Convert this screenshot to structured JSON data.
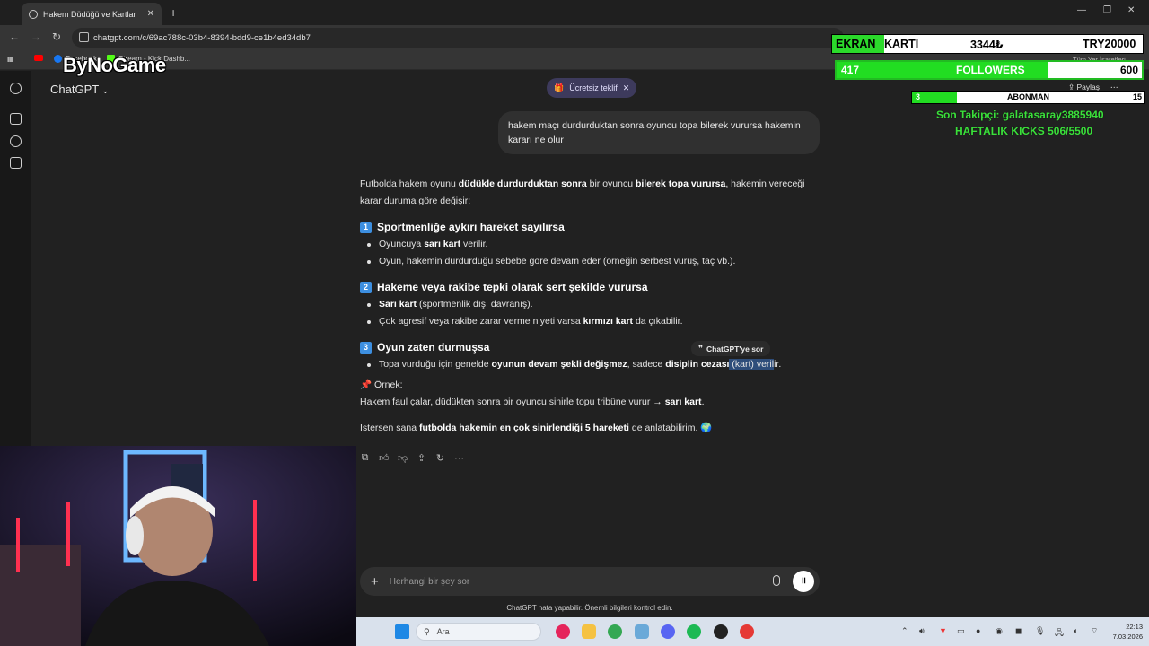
{
  "browser": {
    "tab_title": "Hakem Düdüğü ve Kartlar",
    "url": "chatgpt.com/c/69ac788c-03b4-8394-bdd9-ce1b4ed34db7",
    "bookmarks": [
      "Facebook",
      "Stream - Kick Dashb..."
    ],
    "all_bookmarks": "Tüm Yer İşaretleri"
  },
  "stream_logo": "ByNoGame",
  "app": {
    "model_label": "ChatGPT",
    "offer_label": "Ücretsiz teklif",
    "share_label": "Paylaş"
  },
  "chat": {
    "user_message": "hakem maçı durdurduktan sonra oyuncu topa bilerek vurursa hakemin kararı ne olur",
    "intro": {
      "p1": "Futbolda hakem oyunu ",
      "b1": "düdükle durdurduktan sonra",
      "p2": " bir oyuncu ",
      "b2": "bilerek topa vurursa",
      "p3": ", hakemin vereceği karar duruma göre değişir:"
    },
    "sections": [
      {
        "num": "1",
        "title": "Sportmenliğe aykırı hareket sayılırsa",
        "b1_pre": "Oyuncuya ",
        "b1_bold": "sarı kart",
        "b1_post": " verilir.",
        "b2": "Oyun, hakemin durdurduğu sebebe göre devam eder (örneğin serbest vuruş, taç vb.)."
      },
      {
        "num": "2",
        "title": "Hakeme veya rakibe tepki olarak sert şekilde vurursa",
        "b1_bold": "Sarı kart",
        "b1_post": " (sportmenlik dışı davranış).",
        "b2_pre": "Çok agresif veya rakibe zarar verme niyeti varsa ",
        "b2_bold": "kırmızı kart",
        "b2_post": " da çıkabilir."
      },
      {
        "num": "3",
        "title": "Oyun zaten durmuşsa",
        "b1_pre": "Topa vurduğu için genelde ",
        "b1_bold": "oyunun devam şekli değişmez",
        "b1_mid": ", sadece ",
        "b1_bold2": "disiplin cezası",
        "b1_hl": " (kart) veril",
        "b1_end": "ir."
      }
    ],
    "example_label": "Örnek:",
    "example_text": "Hakem faul çalar, düdükten sonra bir oyuncu sinirle topu tribüne vurur → ",
    "example_bold": "sarı kart",
    "example_end": ".",
    "closing_pre": "İstersen sana ",
    "closing_bold": "futbolda hakemin en çok sinirlendiği 5 hareketi",
    "closing_post": " de anlatabilirim.",
    "ask_tooltip": "ChatGPT'ye sor"
  },
  "composer": {
    "placeholder": "Herhangi bir şey sor",
    "disclaimer": "ChatGPT hata yapabilir. Önemli bilgileri kontrol edin."
  },
  "overlay": {
    "card_label_a": "EKRAN",
    "card_label_b": "KARTI",
    "card_value": "3344₺",
    "card_goal": "TRY20000",
    "followers_current": "417",
    "followers_label": "FOLLOWERS",
    "followers_goal": "600",
    "subs_current": "3",
    "subs_label": "ABONMAN",
    "subs_goal": "15",
    "last_follower": "Son Takipçi: galatasaray3885940",
    "weekly_kicks": "HAFTALIK KICKS 506/5500"
  },
  "taskbar": {
    "search_label": "Ara",
    "time": "22:13",
    "date": "7.03.2026"
  }
}
